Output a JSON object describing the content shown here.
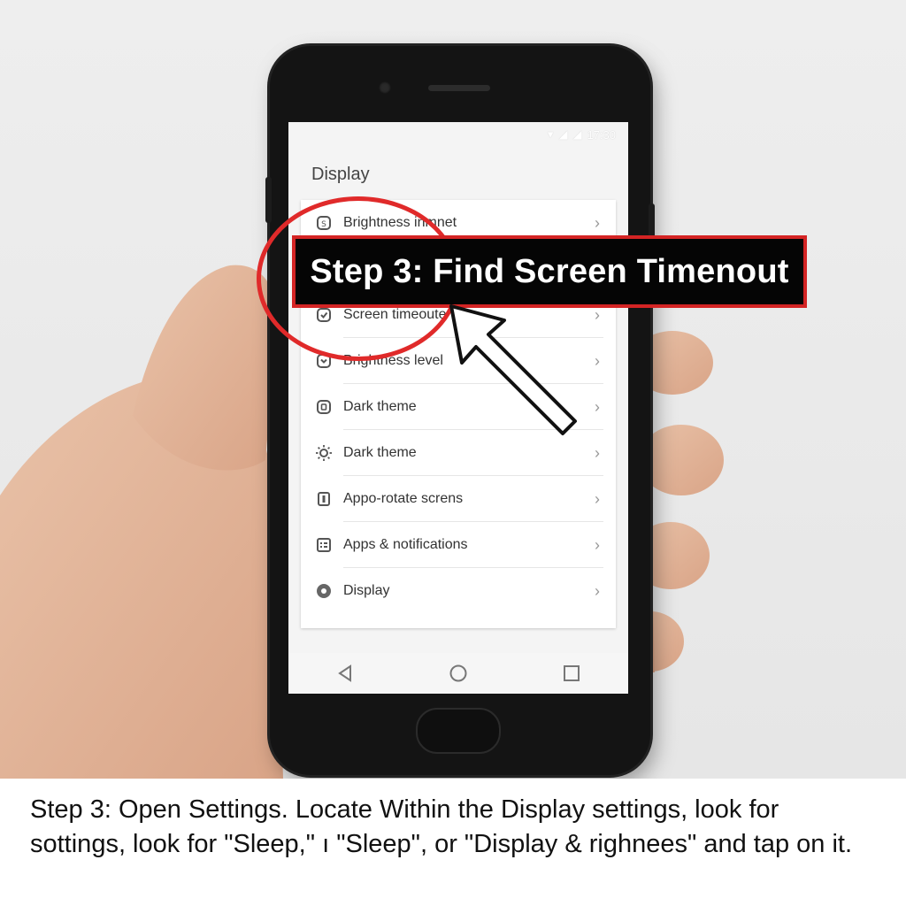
{
  "status_bar": {
    "time": "17:30",
    "icons": [
      "wifi-icon",
      "signal-icon",
      "signal-icon"
    ]
  },
  "screen": {
    "title": "Display",
    "items": [
      {
        "label": "Brightness inmnet",
        "icon": "brightness-icon"
      },
      {
        "label": "",
        "icon": ""
      },
      {
        "label": "Screen timeoute",
        "icon": "timer-icon"
      },
      {
        "label": "Brightness level",
        "icon": "brightness-level-icon"
      },
      {
        "label": "Dark theme",
        "icon": "dark-theme-icon"
      },
      {
        "label": "Dark theme",
        "icon": "sun-icon"
      },
      {
        "label": "Appo-rotate screns",
        "icon": "rotate-icon"
      },
      {
        "label": "Apps & notifications",
        "icon": "apps-icon"
      },
      {
        "label": "Display",
        "icon": "display-icon"
      }
    ]
  },
  "nav": {
    "back": "back-icon",
    "home": "home-icon",
    "recents": "recents-icon"
  },
  "annotation": {
    "banner_text": "Step 3: Find Screen Timenout",
    "accent_color": "#e02a2a"
  },
  "caption": {
    "text": "Step 3: Open Settings. Locate Within the Display settings,  look for sottings, look for \"Sleep,\" ı \"Sleep\", or \"Display & righnees\" and tap on it."
  }
}
